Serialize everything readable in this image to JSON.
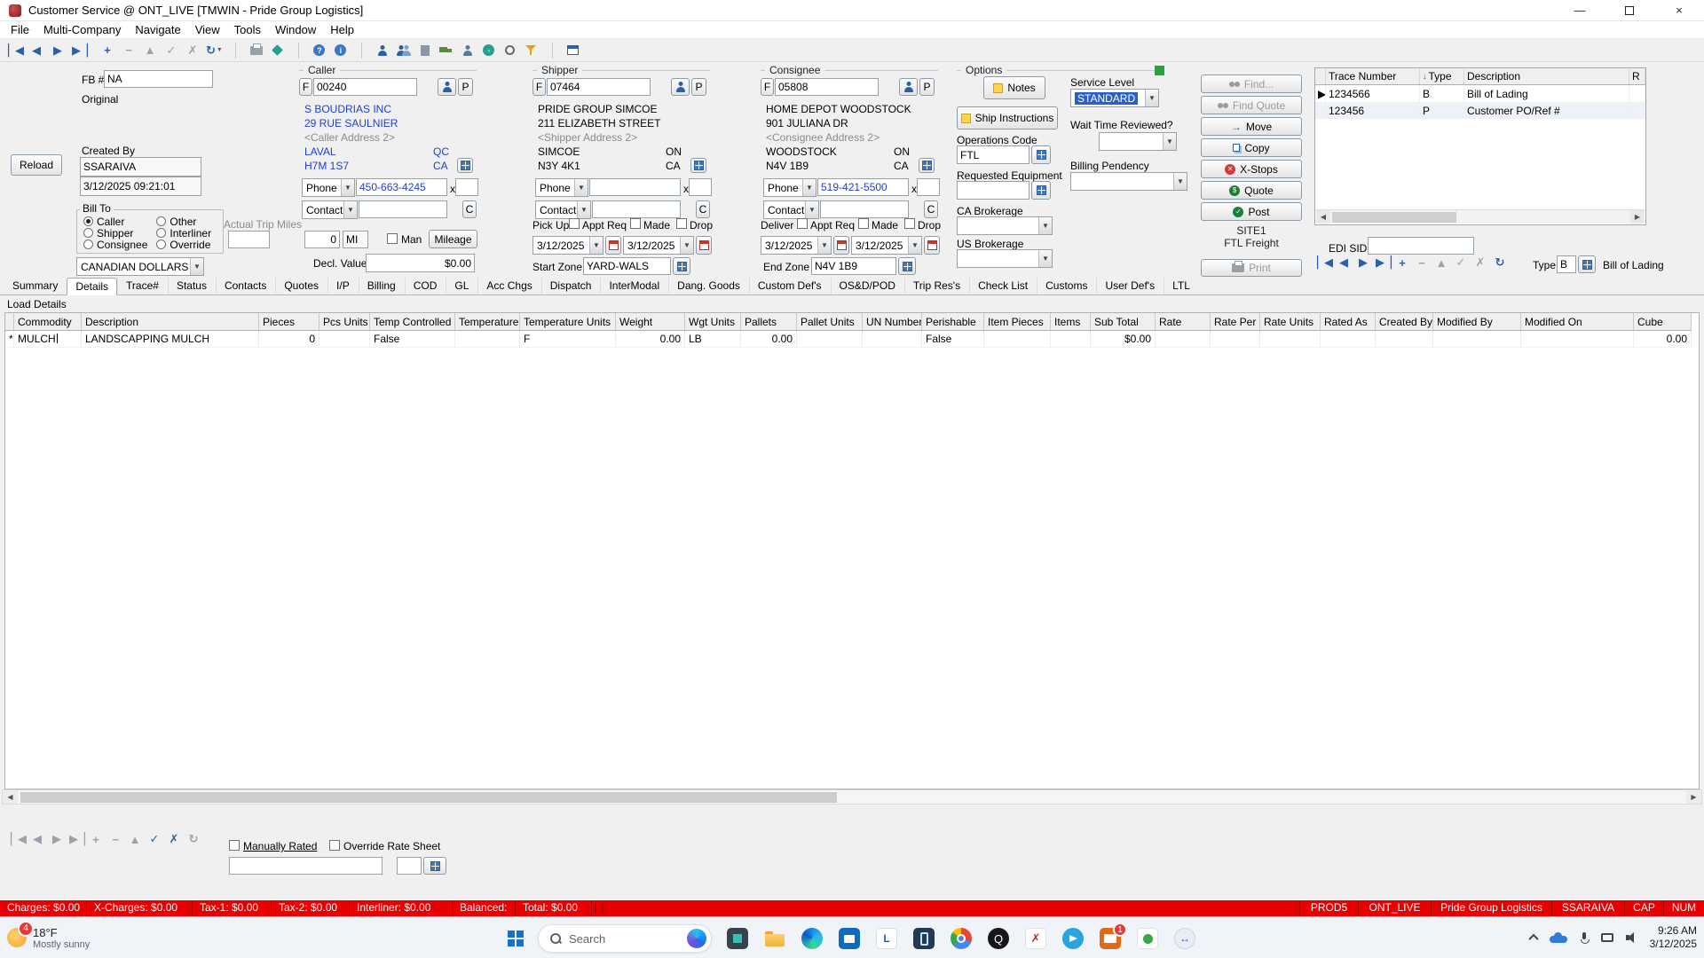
{
  "window": {
    "title": "Customer Service @ ONT_LIVE [TMWIN - Pride Group Logistics]"
  },
  "menu": {
    "items": [
      "File",
      "Multi-Company",
      "Navigate",
      "View",
      "Tools",
      "Window",
      "Help"
    ]
  },
  "toolbar": {
    "icons": [
      "first-record",
      "prior-record",
      "next-record",
      "last-record",
      "insert-record",
      "delete-record",
      "edit-record",
      "post-edit",
      "cancel-edit",
      "refresh",
      "print",
      "labels",
      "web-help",
      "about",
      "customer",
      "contacts",
      "company",
      "truck",
      "driver",
      "anchor",
      "filter",
      "window"
    ]
  },
  "form": {
    "fb_label": "FB #",
    "fb_value": "NA",
    "original_label": "Original",
    "reload_button": "Reload",
    "created_by_label": "Created By",
    "created_by_user": "SSARAIVA",
    "created_by_date": "3/12/2025 09:21:01",
    "bill_to_label": "Bill To",
    "bill_to_options": [
      {
        "label": "Caller",
        "selected": true
      },
      {
        "label": "Shipper",
        "selected": false
      },
      {
        "label": "Consignee",
        "selected": false
      },
      {
        "label": "Other",
        "selected": false
      },
      {
        "label": "Interliner",
        "selected": false
      },
      {
        "label": "Override",
        "selected": false
      }
    ],
    "currency": "CANADIAN DOLLARS",
    "actual_trip_miles_label": "Actual Trip Miles"
  },
  "caller": {
    "section_label": "Caller",
    "f_button": "F",
    "code": "00240",
    "p_button": "P",
    "name": "S BOUDRIAS INC",
    "address1": "29 RUE SAULNIER",
    "address2": "<Caller Address 2>",
    "city": "LAVAL",
    "region": "QC",
    "postal": "H7M 1S7",
    "country": "CA",
    "phone_label": "Phone",
    "phone": "450-663-4245",
    "ext_label": "x",
    "contact_label": "Contact",
    "c_button": "C",
    "miles_value": "0",
    "miles_unit": "MI",
    "man_label": "Man",
    "mileage_button": "Mileage",
    "decl_value_label": "Decl. Value",
    "decl_value": "$0.00"
  },
  "shipper": {
    "section_label": "Shipper",
    "f_button": "F",
    "code": "07464",
    "p_button": "P",
    "name": "PRIDE GROUP SIMCOE",
    "address1": "211 ELIZABETH STREET",
    "address2": "<Shipper Address 2>",
    "city": "SIMCOE",
    "region": "ON",
    "postal": "N3Y 4K1",
    "country": "CA",
    "phone_label": "Phone",
    "phone": "",
    "ext_label": "x",
    "contact_label": "Contact",
    "c_button": "C",
    "pickup_label": "Pick Up",
    "appt_req_label": "Appt Req",
    "made_label": "Made",
    "drop_label": "Drop",
    "date_from": "3/12/2025",
    "date_to": "3/12/2025",
    "start_zone_label": "Start Zone",
    "start_zone": "YARD-WALS"
  },
  "consignee": {
    "section_label": "Consignee",
    "f_button": "F",
    "code": "05808",
    "p_button": "P",
    "name": "HOME DEPOT WOODSTOCK",
    "address1": "901 JULIANA DR",
    "address2": "<Consignee Address 2>",
    "city": "WOODSTOCK",
    "region": "ON",
    "postal": "N4V 1B9",
    "country": "CA",
    "phone_label": "Phone",
    "phone": "519-421-5500",
    "ext_label": "x",
    "contact_label": "Contact",
    "c_button": "C",
    "deliver_label": "Deliver",
    "appt_req_label": "Appt Req",
    "made_label": "Made",
    "drop_label": "Drop",
    "date_from": "3/12/2025",
    "date_to": "3/12/2025",
    "end_zone_label": "End Zone",
    "end_zone": "N4V 1B9"
  },
  "options": {
    "section_label": "Options",
    "notes_button": "Notes",
    "ship_instructions_button": "Ship Instructions",
    "operations_code_label": "Operations Code",
    "operations_code": "FTL",
    "requested_equipment_label": "Requested Equipment",
    "requested_equipment": "",
    "ca_brokerage_label": "CA Brokerage",
    "us_brokerage_label": "US Brokerage"
  },
  "service": {
    "service_level_label": "Service Level",
    "service_level": "STANDARD",
    "wait_time_label": "Wait Time Reviewed?",
    "billing_pendency_label": "Billing Pendency"
  },
  "actions": {
    "find": "Find...",
    "find_quote": "Find Quote",
    "move": "Move",
    "copy": "Copy",
    "x_stops": "X-Stops",
    "quote": "Quote",
    "post": "Post",
    "site_line1": "SITE1",
    "site_line2": "FTL Freight",
    "print": "Print"
  },
  "trace": {
    "h_number": "Trace Number",
    "h_type": "Type",
    "h_desc": "Description",
    "h_r": "R",
    "sort_icon": "↓",
    "rows": [
      {
        "marker": "▶",
        "number": "1234566",
        "type": "B",
        "description": "Bill of Lading"
      },
      {
        "marker": "",
        "number": "123456",
        "type": "P",
        "description": "Customer PO/Ref #"
      }
    ],
    "edi_sid_label": "EDI SID",
    "type_label": "Type",
    "type_value": "B",
    "type_description": "Bill of Lading"
  },
  "tabs": [
    {
      "label": "Summary"
    },
    {
      "label": "Details",
      "active": true
    },
    {
      "label": "Trace#"
    },
    {
      "label": "Status"
    },
    {
      "label": "Contacts"
    },
    {
      "label": "Quotes"
    },
    {
      "label": "I/P"
    },
    {
      "label": "Billing"
    },
    {
      "label": "COD"
    },
    {
      "label": "GL"
    },
    {
      "label": "Acc Chgs"
    },
    {
      "label": "Dispatch"
    },
    {
      "label": "InterModal"
    },
    {
      "label": "Dang. Goods"
    },
    {
      "label": "Custom Def's"
    },
    {
      "label": "OS&D/POD"
    },
    {
      "label": "Trip Res's"
    },
    {
      "label": "Check List"
    },
    {
      "label": "Customs"
    },
    {
      "label": "User Def's"
    },
    {
      "label": "LTL"
    }
  ],
  "load": {
    "title": "Load Details",
    "marker": "*",
    "headers": [
      "Commodity",
      "Description",
      "Pieces",
      "Pcs Units",
      "Temp Controlled",
      "Temperature",
      "Temperature Units",
      "Weight",
      "Wgt Units",
      "Pallets",
      "Pallet Units",
      "UN Number",
      "Perishable",
      "Item Pieces",
      "Items",
      "Sub Total",
      "Rate",
      "Rate Per",
      "Rate Units",
      "Rated As",
      "Created By",
      "Modified By",
      "Modified On",
      "Cube"
    ],
    "cells": [
      "MULCH",
      "LANDSCAPPING MULCH",
      "0",
      "",
      "False",
      "",
      "F",
      "0.00",
      "LB",
      "0.00",
      "",
      "",
      "False",
      "",
      "",
      "$0.00",
      "",
      "",
      "",
      "",
      "",
      "",
      "",
      "0.00"
    ]
  },
  "rating": {
    "manually_rated_label": "Manually Rated",
    "override_rate_sheet_label": "Override Rate Sheet"
  },
  "statusbar": {
    "left": [
      "Charges: $0.00",
      "X-Charges: $0.00",
      "Tax-1: $0.00",
      "Tax-2: $0.00",
      "Interliner: $0.00",
      "Balanced:",
      "Total: $0.00"
    ],
    "right": [
      "PROD5",
      "ONT_LIVE",
      "Pride Group Logistics",
      "SSARAIVA",
      "CAP",
      "NUM"
    ]
  },
  "taskbar": {
    "weather_badge": "4",
    "temp": "18°F",
    "condition": "Mostly sunny",
    "search_label": "Search",
    "mail_badge": "1",
    "time": "9:26 AM",
    "date": "3/12/2025"
  }
}
